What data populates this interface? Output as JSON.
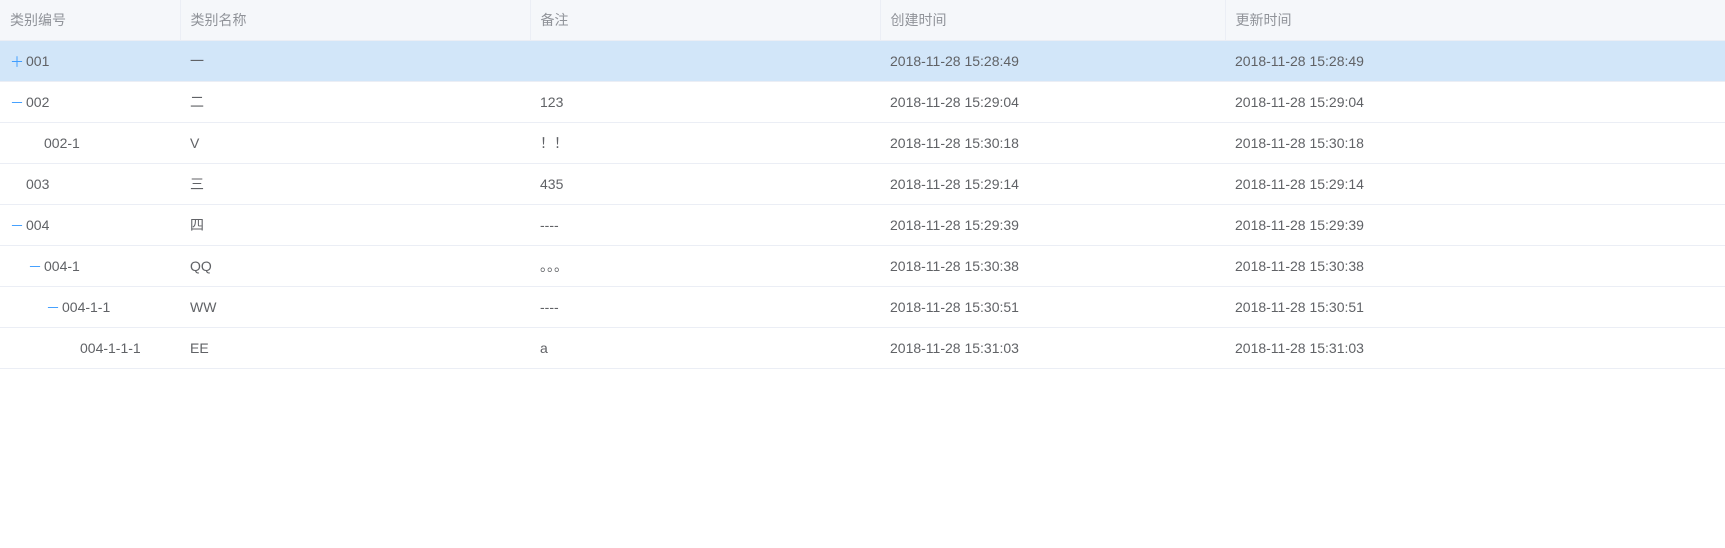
{
  "columns": {
    "code": "类别编号",
    "name": "类别名称",
    "remark": "备注",
    "created": "创建时间",
    "updated": "更新时间"
  },
  "rows": [
    {
      "code": "001",
      "name": "一",
      "remark": "",
      "created": "2018-11-28 15:28:49",
      "updated": "2018-11-28 15:28:49",
      "level": 0,
      "expand": "plus",
      "selected": true
    },
    {
      "code": "002",
      "name": "二",
      "remark": "123",
      "created": "2018-11-28 15:29:04",
      "updated": "2018-11-28 15:29:04",
      "level": 0,
      "expand": "minus",
      "selected": false
    },
    {
      "code": "002-1",
      "name": "V",
      "remark": "！！",
      "created": "2018-11-28 15:30:18",
      "updated": "2018-11-28 15:30:18",
      "level": 1,
      "expand": "none",
      "selected": false
    },
    {
      "code": "003",
      "name": "三",
      "remark": "435",
      "created": "2018-11-28 15:29:14",
      "updated": "2018-11-28 15:29:14",
      "level": 0,
      "expand": "none",
      "selected": false
    },
    {
      "code": "004",
      "name": "四",
      "remark": "----",
      "created": "2018-11-28 15:29:39",
      "updated": "2018-11-28 15:29:39",
      "level": 0,
      "expand": "minus",
      "selected": false
    },
    {
      "code": "004-1",
      "name": "QQ",
      "remark": "。。。",
      "created": "2018-11-28 15:30:38",
      "updated": "2018-11-28 15:30:38",
      "level": 1,
      "expand": "minus",
      "selected": false
    },
    {
      "code": "004-1-1",
      "name": "WW",
      "remark": "----",
      "created": "2018-11-28 15:30:51",
      "updated": "2018-11-28 15:30:51",
      "level": 2,
      "expand": "minus",
      "selected": false
    },
    {
      "code": "004-1-1-1",
      "name": "EE",
      "remark": "a",
      "created": "2018-11-28 15:31:03",
      "updated": "2018-11-28 15:31:03",
      "level": 3,
      "expand": "none",
      "selected": false
    }
  ],
  "icons": {
    "plus": "＋",
    "minus": "－",
    "none": ""
  }
}
